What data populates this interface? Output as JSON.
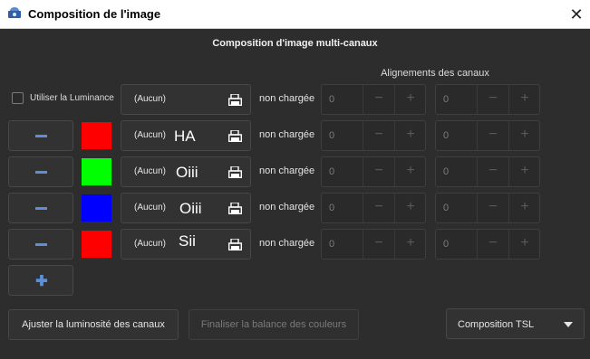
{
  "window": {
    "title": "Composition de l'image",
    "close_symbol": "✕"
  },
  "dialog": {
    "heading": "Composition d'image multi-canaux",
    "alignment_heading": "Alignements des canaux"
  },
  "luminance": {
    "checkbox_label": "Utiliser la Luminance",
    "checked": false,
    "file_text": "(Aucun)",
    "status": "non chargée",
    "x": "0",
    "y": "0"
  },
  "channels": [
    {
      "color": "#ff0000",
      "file_text": "(Aucun)",
      "name_overlay": "HA",
      "status": "non chargée",
      "x": "0",
      "y": "0"
    },
    {
      "color": "#00ff00",
      "file_text": "(Aucun)",
      "name_overlay": "Oiii",
      "status": "non chargée",
      "x": "0",
      "y": "0"
    },
    {
      "color": "#0000ff",
      "file_text": "(Aucun)",
      "name_overlay": "Oiii",
      "status": "non chargée",
      "x": "0",
      "y": "0"
    },
    {
      "color": "#ff0000",
      "file_text": "(Aucun)",
      "name_overlay": "Sii",
      "status": "non chargée",
      "x": "0",
      "y": "0"
    }
  ],
  "spin_symbols": {
    "minus": "−",
    "plus": "+"
  },
  "add_channel_symbol": "✚",
  "buttons": {
    "adjust_luminosity": "Ajuster la luminosité des canaux",
    "finalize_balance": "Finaliser la balance des couleurs",
    "composition_mode": "Composition TSL"
  },
  "colors": {
    "accent": "#5b8fd8",
    "background": "#2d2d2d"
  }
}
